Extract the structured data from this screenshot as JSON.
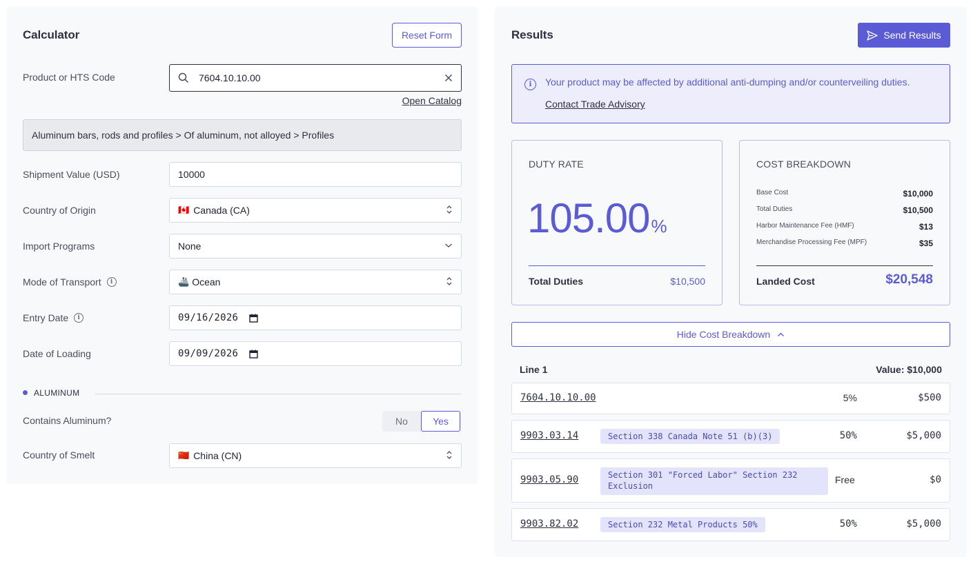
{
  "calculator": {
    "title": "Calculator",
    "reset_label": "Reset Form",
    "product_label": "Product or HTS Code",
    "product_value": "7604.10.10.00",
    "open_catalog": "Open Catalog",
    "product_path": "Aluminum bars, rods and profiles > Of aluminum, not alloyed > Profiles",
    "shipment_label": "Shipment Value (USD)",
    "shipment_value": "10000",
    "origin_label": "Country of Origin",
    "origin_flag": "🇨🇦",
    "origin_value": "Canada (CA)",
    "programs_label": "Import Programs",
    "programs_value": "None",
    "transport_label": "Mode of Transport",
    "transport_icon": "🚢",
    "transport_value": "Ocean",
    "entry_label": "Entry Date",
    "entry_value": "09/16/2026",
    "loading_label": "Date of Loading",
    "loading_value": "09/09/2026",
    "section_label": "ALUMINUM",
    "contains_label": "Contains Aluminum?",
    "toggle_no": "No",
    "toggle_yes": "Yes",
    "smelt_label": "Country of Smelt",
    "smelt_flag": "🇨🇳",
    "smelt_value": "China (CN)"
  },
  "results": {
    "title": "Results",
    "send_label": "Send Results",
    "alert_text": "Your product may be affected by additional anti-dumping and/or counterveiling duties.",
    "alert_link": "Contact Trade Advisory",
    "duty_card": {
      "heading": "DUTY RATE",
      "rate": "105.00",
      "rate_unit": "%",
      "total_label": "Total Duties",
      "total_value": "$10,500"
    },
    "cost_card": {
      "heading": "COST BREAKDOWN",
      "rows": [
        {
          "label": "Base Cost",
          "value": "$10,000"
        },
        {
          "label": "Total Duties",
          "value": "$10,500"
        },
        {
          "label": "Harbor Maintenance Fee (HMF)",
          "value": "$13"
        },
        {
          "label": "Merchandise Processing Fee (MPF)",
          "value": "$35"
        }
      ],
      "landed_label": "Landed Cost",
      "landed_value": "$20,548"
    },
    "hide_breakdown": "Hide Cost Breakdown",
    "line_title": "Line 1",
    "line_value": "Value: $10,000",
    "lines": [
      {
        "hts": "7604.10.10.00",
        "tag": "",
        "rate": "5%",
        "amount": "$500"
      },
      {
        "hts": "9903.03.14",
        "tag": "Section 338 Canada Note 51 (b)(3)",
        "rate": "50%",
        "amount": "$5,000"
      },
      {
        "hts": "9903.05.90",
        "tag": "Section 301 \"Forced Labor\" Section 232 Exclusion",
        "rate": "Free",
        "amount": "$0"
      },
      {
        "hts": "9903.82.02",
        "tag": "Section 232 Metal Products 50%",
        "rate": "50%",
        "amount": "$5,000"
      }
    ]
  },
  "colors": {
    "accent": "#5b5bd6",
    "tag_bg": "#e3e3fb",
    "panel_bg": "#f8f9fb"
  },
  "icons": {
    "search": "search-icon",
    "clear": "close-icon",
    "select": "updown-chevron-icon",
    "dropdown": "chevron-down-icon",
    "calendar": "calendar-icon",
    "info": "info-icon",
    "send": "send-icon",
    "collapse": "chevron-up-icon"
  }
}
